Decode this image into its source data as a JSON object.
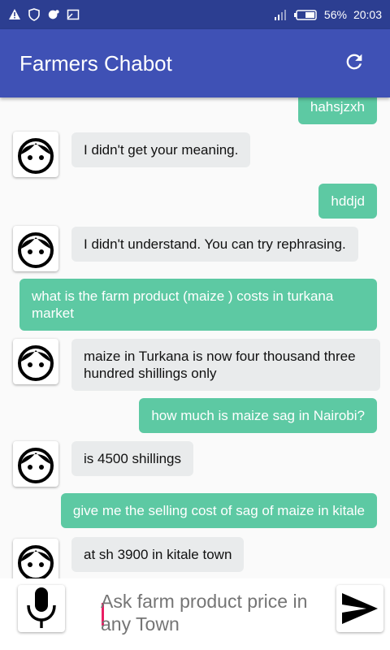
{
  "status_bar": {
    "battery": "56%",
    "time": "20:03"
  },
  "app_bar": {
    "title": "Farmers Chabot",
    "refresh_icon": "refresh-icon"
  },
  "messages": [
    {
      "from": "user",
      "text": "hahsjzxh"
    },
    {
      "from": "bot",
      "text": "I didn't get your meaning."
    },
    {
      "from": "user",
      "text": "hddjd"
    },
    {
      "from": "bot",
      "text": "I didn't understand. You can try rephrasing."
    },
    {
      "from": "user",
      "text": "what is the farm product (maize ) costs in turkana market"
    },
    {
      "from": "bot",
      "text": "maize in Turkana is now four thousand three hundred shillings only"
    },
    {
      "from": "user",
      "text": "how much is maize sag in Nairobi?"
    },
    {
      "from": "bot",
      "text": "is 4500 shillings"
    },
    {
      "from": "user",
      "text": "give me the selling cost of sag of maize in kitale"
    },
    {
      "from": "bot",
      "text": "at sh 3900 in kitale town"
    }
  ],
  "input": {
    "placeholder": "Ask farm product price in any Town",
    "value": ""
  },
  "colors": {
    "app_bar": "#3f51b5",
    "status_bar": "#2c3e91",
    "user_bubble": "#5dc9a3",
    "bot_bubble": "#e9ebec"
  }
}
